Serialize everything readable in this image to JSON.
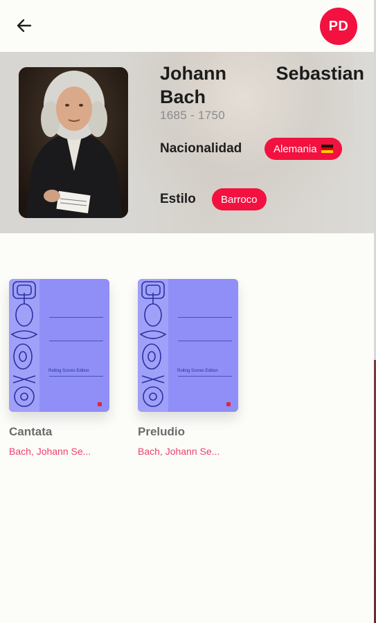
{
  "appbar": {
    "back_icon": "arrow-left-icon",
    "avatar_initials": "PD",
    "accent_color": "#f2113f"
  },
  "composer": {
    "name_first": "Johann",
    "name_middle": "Sebastian",
    "name_last": "Bach",
    "years": "1685 - 1750",
    "nationality_label": "Nacionalidad",
    "nationality_value": "Alemania",
    "nationality_flag": "germany-flag-icon",
    "style_label": "Estilo",
    "style_value": "Barroco"
  },
  "works": [
    {
      "title": "Cantata",
      "composer": "Bach, Johann Se...",
      "cover_text": "Rolling Scores Edition"
    },
    {
      "title": "Preludio",
      "composer": "Bach, Johann Se...",
      "cover_text": "Rolling Scores Edition"
    }
  ]
}
